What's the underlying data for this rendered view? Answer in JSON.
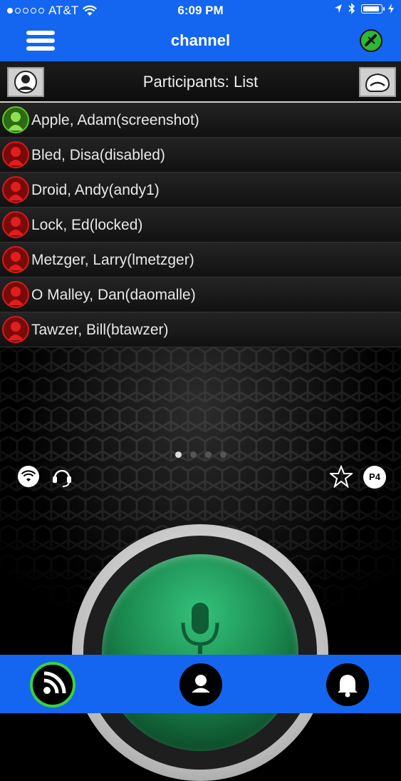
{
  "status_bar": {
    "carrier": "AT&T",
    "time": "6:09 PM"
  },
  "nav": {
    "title": "channel"
  },
  "participants_header": {
    "title": "Participants: List"
  },
  "participants": [
    {
      "name": "Apple, Adam(screenshot)",
      "status": "online"
    },
    {
      "name": "Bled, Disa(disabled)",
      "status": "offline"
    },
    {
      "name": "Droid, Andy(andy1)",
      "status": "offline"
    },
    {
      "name": "Lock, Ed(locked)",
      "status": "offline"
    },
    {
      "name": "Metzger, Larry(lmetzger)",
      "status": "offline"
    },
    {
      "name": "O Malley, Dan(daomalle)",
      "status": "offline"
    },
    {
      "name": "Tawzer, Bill(btawzer)",
      "status": "offline"
    }
  ],
  "controls": {
    "priority_label": "P4"
  },
  "pager": {
    "pages": 4,
    "active": 1
  },
  "tabs": [
    {
      "icon": "rss-feed-icon",
      "active": true
    },
    {
      "icon": "contact-icon",
      "active": false
    },
    {
      "icon": "bell-icon",
      "active": false
    }
  ],
  "colors": {
    "accent": "#1466f0",
    "online": "#5ec52a",
    "offline": "#d21c1c",
    "ptt": "#1b8a4f"
  }
}
